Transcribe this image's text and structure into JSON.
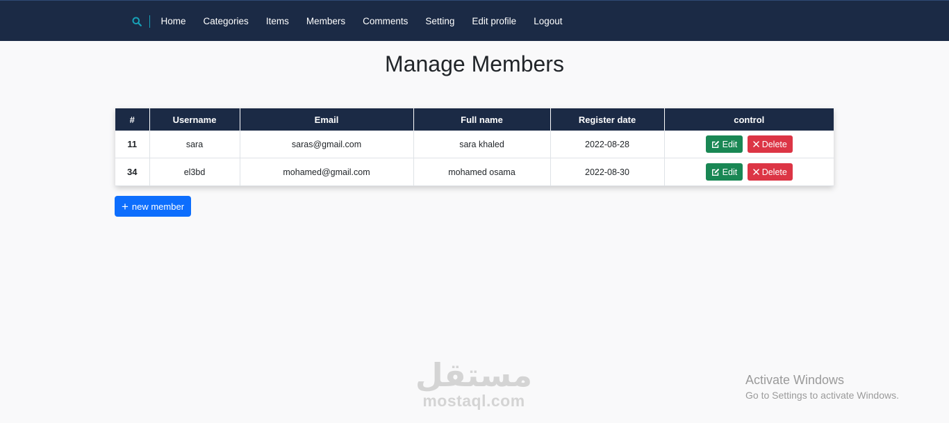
{
  "navbar": {
    "links": [
      "Home",
      "Categories",
      "Items",
      "Members",
      "Comments",
      "Setting",
      "Edit profile",
      "Logout"
    ]
  },
  "page": {
    "title": "Manage Members"
  },
  "table": {
    "headers": [
      "#",
      "Username",
      "Email",
      "Full name",
      "Register date",
      "control"
    ],
    "rows": [
      {
        "id": "11",
        "username": "sara",
        "email": "saras@gmail.com",
        "full_name": "sara khaled",
        "register_date": "2022-08-28"
      },
      {
        "id": "34",
        "username": "el3bd",
        "email": "mohamed@gmail.com",
        "full_name": "mohamed osama",
        "register_date": "2022-08-30"
      }
    ],
    "edit_label": "Edit",
    "delete_label": "Delete"
  },
  "actions": {
    "new_member_label": "new member"
  },
  "watermark": {
    "arabic": "مستقل",
    "latin": "mostaql.com"
  },
  "os_notice": {
    "title": "Activate Windows",
    "subtitle": "Go to Settings to activate Windows."
  },
  "colors": {
    "navbar_bg": "#1b2a45",
    "search_accent": "#17a2b8",
    "edit_button": "#198754",
    "delete_button": "#dc3545",
    "primary_button": "#0d6efd"
  },
  "icons": {
    "search": "search-icon",
    "edit": "edit-icon",
    "delete": "close-icon",
    "add": "plus-icon"
  }
}
